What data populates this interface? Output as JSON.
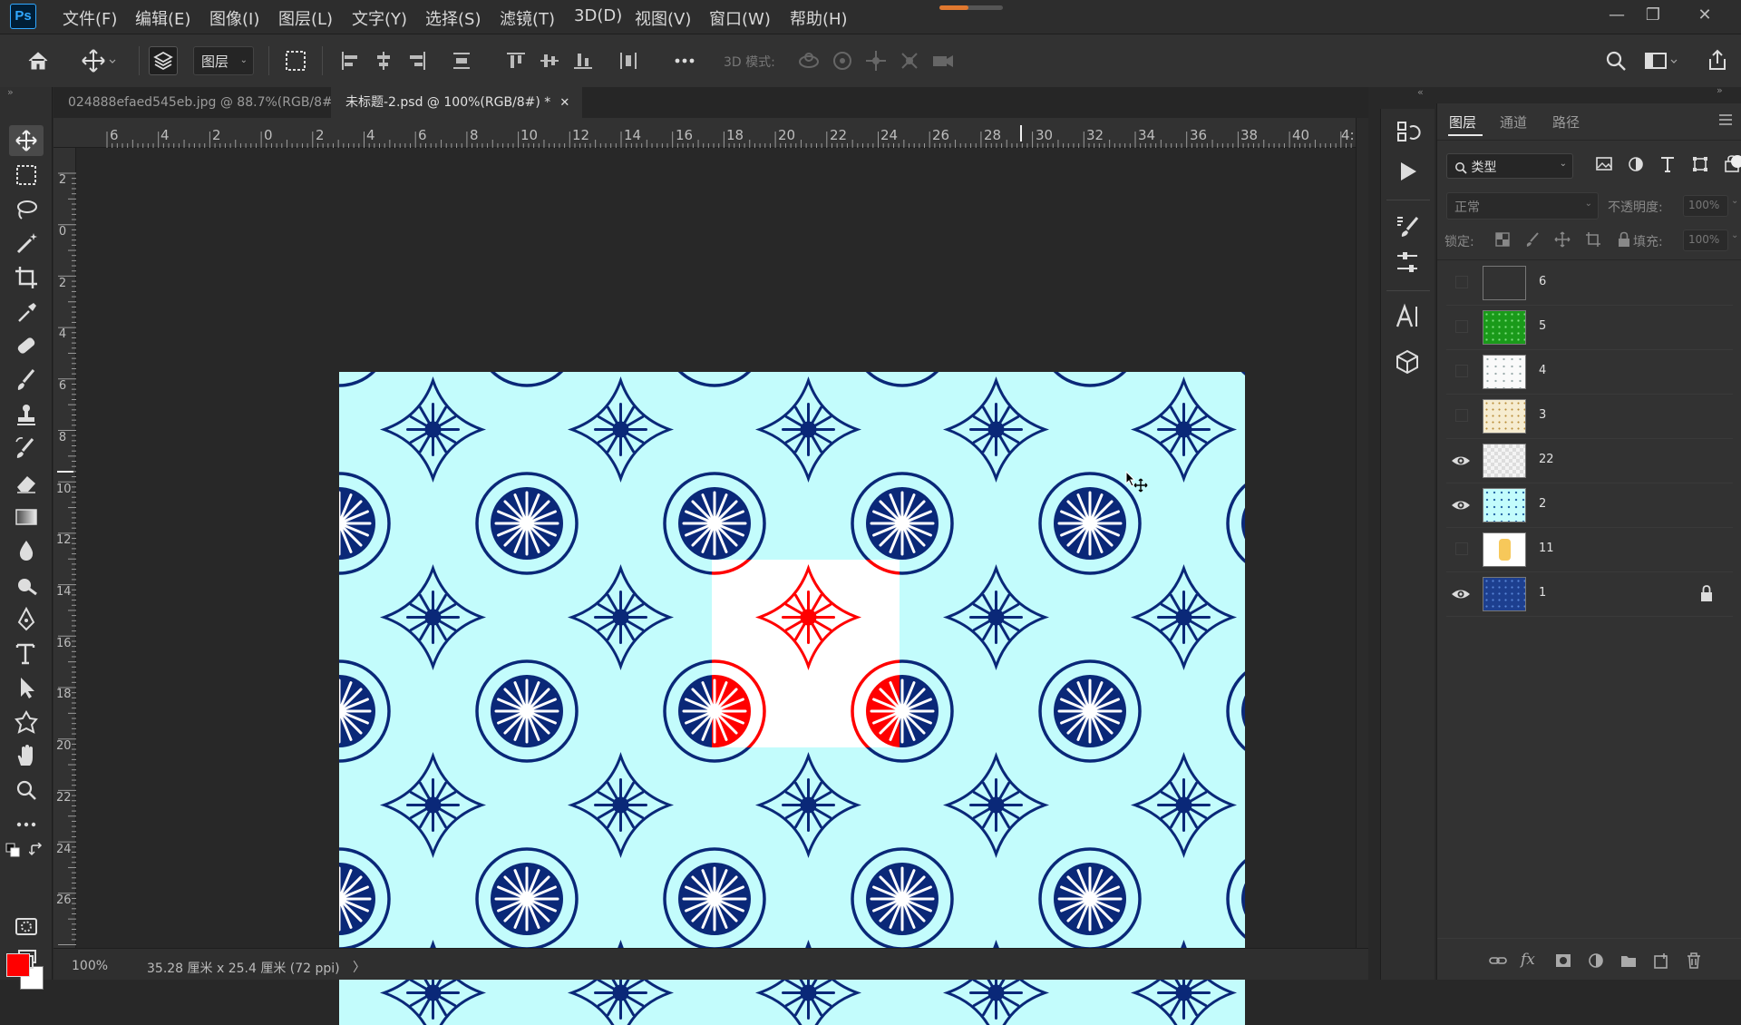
{
  "app": {
    "logo": "Ps"
  },
  "menu": [
    "文件(F)",
    "编辑(E)",
    "图像(I)",
    "图层(L)",
    "文字(Y)",
    "选择(S)",
    "滤镜(T)",
    "3D(D)",
    "视图(V)",
    "窗口(W)",
    "帮助(H)"
  ],
  "progress": {
    "value": 0.45,
    "color": "#e0782f"
  },
  "options": {
    "auto_select_target": "图层",
    "mode_3d_label": "3D 模式:"
  },
  "tabs": [
    {
      "label": "024888efaed545eb.jpg @ 88.7%(RGB/8#) *",
      "active": false
    },
    {
      "label": "未标题-2.psd @ 100%(RGB/8#) *",
      "active": true
    }
  ],
  "rulers": {
    "horizontal": [
      "6",
      "4",
      "2",
      "0",
      "2",
      "4",
      "6",
      "8",
      "10",
      "12",
      "14",
      "16",
      "18",
      "20",
      "22",
      "24",
      "26",
      "28",
      "30",
      "32",
      "34",
      "36",
      "38",
      "40",
      "4:"
    ],
    "vertical": [
      "2",
      "0",
      "2",
      "4",
      "6",
      "8",
      "10",
      "12",
      "14",
      "16",
      "18",
      "20",
      "22",
      "24",
      "26"
    ]
  },
  "status": {
    "zoom": "100%",
    "doc_size": "35.28 厘米 x 25.4 厘米 (72 ppi)",
    "arrow": "〉"
  },
  "colors": {
    "foreground": "#ff0000",
    "background": "#ffffff",
    "canvas": "#c3fcfc",
    "pattern_blue": "#0a2878",
    "highlight_red": "#ff0000"
  },
  "layers_panel": {
    "tabs": [
      "图层",
      "通道",
      "路径"
    ],
    "filter_label": "类型",
    "blend_mode": "正常",
    "opacity_label": "不透明度:",
    "opacity_value": "100%",
    "lock_label": "锁定:",
    "fill_label": "填充:",
    "fill_value": "100%",
    "layers": [
      {
        "name": "6",
        "visible": false,
        "thumb": "red-hearts",
        "locked": false
      },
      {
        "name": "5",
        "visible": false,
        "thumb": "green-dots",
        "locked": false
      },
      {
        "name": "4",
        "visible": false,
        "thumb": "white-dots",
        "locked": false
      },
      {
        "name": "3",
        "visible": false,
        "thumb": "cream-dots",
        "locked": false
      },
      {
        "name": "22",
        "visible": true,
        "thumb": "gray-grid",
        "locked": false
      },
      {
        "name": "2",
        "visible": true,
        "thumb": "cyan-dots",
        "locked": false
      },
      {
        "name": "11",
        "visible": false,
        "thumb": "yellow-figure",
        "locked": false
      },
      {
        "name": "1",
        "visible": true,
        "thumb": "blue-pattern",
        "locked": true
      }
    ]
  }
}
